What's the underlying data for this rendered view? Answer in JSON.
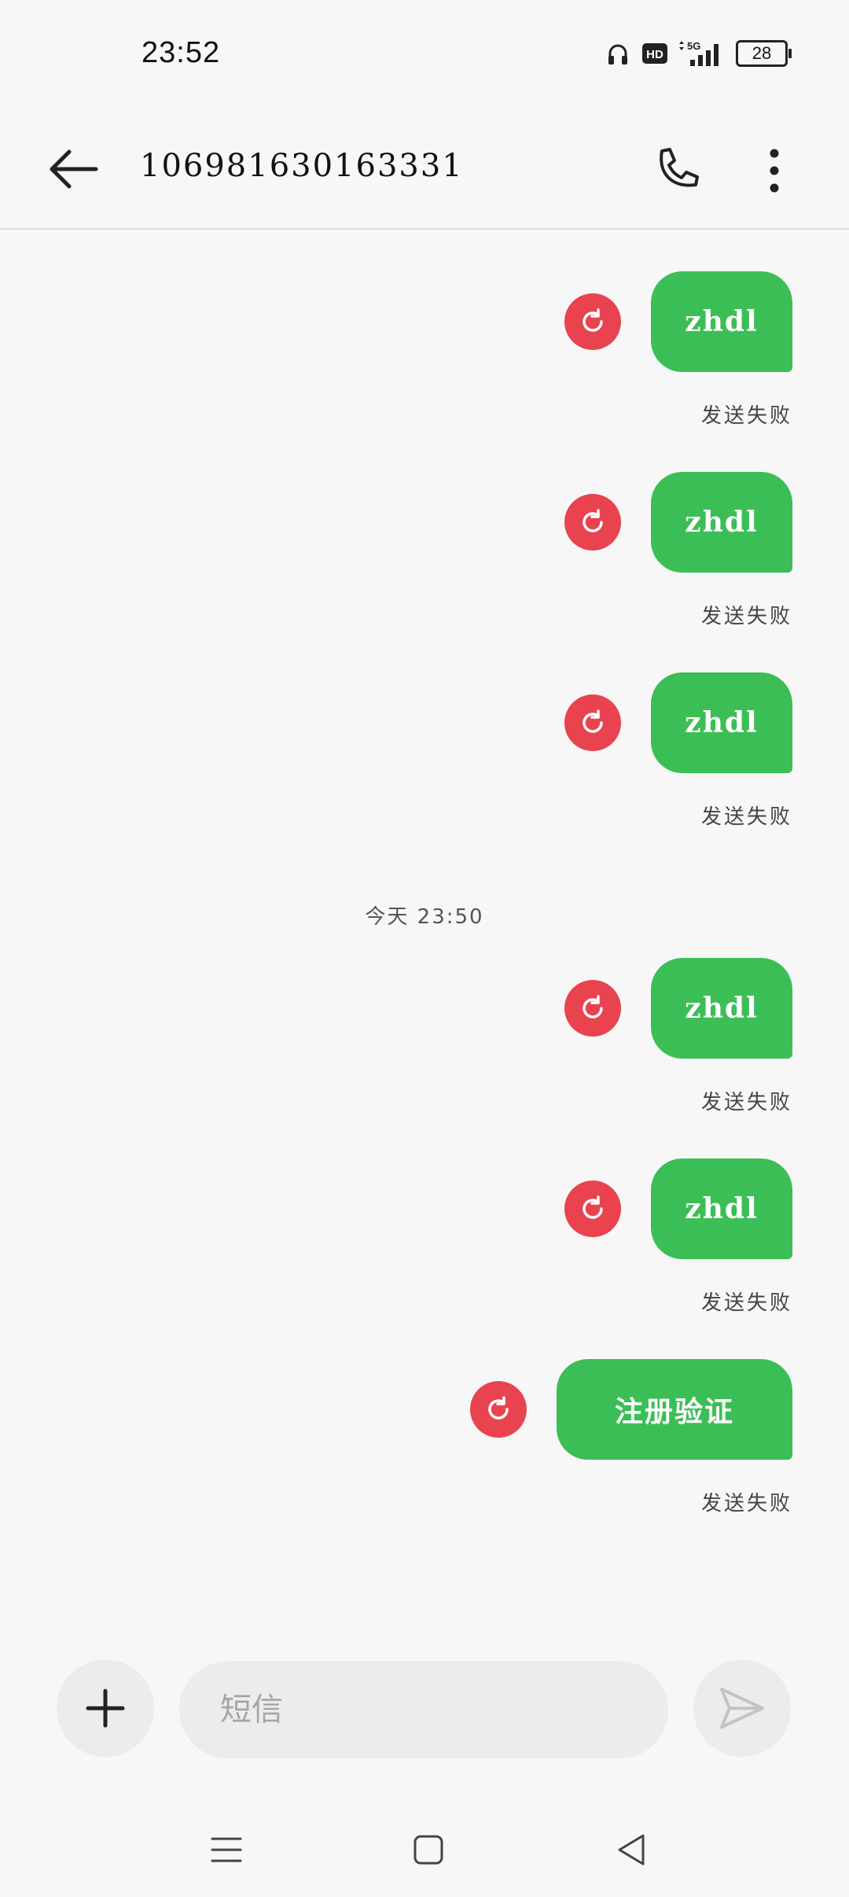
{
  "status_bar": {
    "time": "23:52",
    "battery": "28",
    "icons": [
      "headphones-icon",
      "hd-icon",
      "5g-signal-icon",
      "battery-icon"
    ]
  },
  "header": {
    "title": "106981630163331",
    "icons": [
      "back-arrow-icon",
      "phone-icon",
      "more-vertical-icon"
    ]
  },
  "messages": [
    {
      "text": "zhdl",
      "status": "发送失败"
    },
    {
      "text": "zhdl",
      "status": "发送失败"
    },
    {
      "text": "zhdl",
      "status": "发送失败"
    },
    {
      "date_separator": "今天 23:50"
    },
    {
      "text": "zhdl",
      "status": "发送失败"
    },
    {
      "text": "zhdl",
      "status": "发送失败"
    },
    {
      "text": "注册验证",
      "status": "发送失败"
    }
  ],
  "composer": {
    "placeholder": "短信",
    "icons": [
      "plus-icon",
      "send-icon"
    ]
  },
  "nav_bar": {
    "icons": [
      "menu-icon",
      "home-icon",
      "back-triangle-icon"
    ]
  },
  "colors": {
    "bubble": "#3cbe56",
    "retry": "#e8434f",
    "background": "#f7f7f7"
  }
}
